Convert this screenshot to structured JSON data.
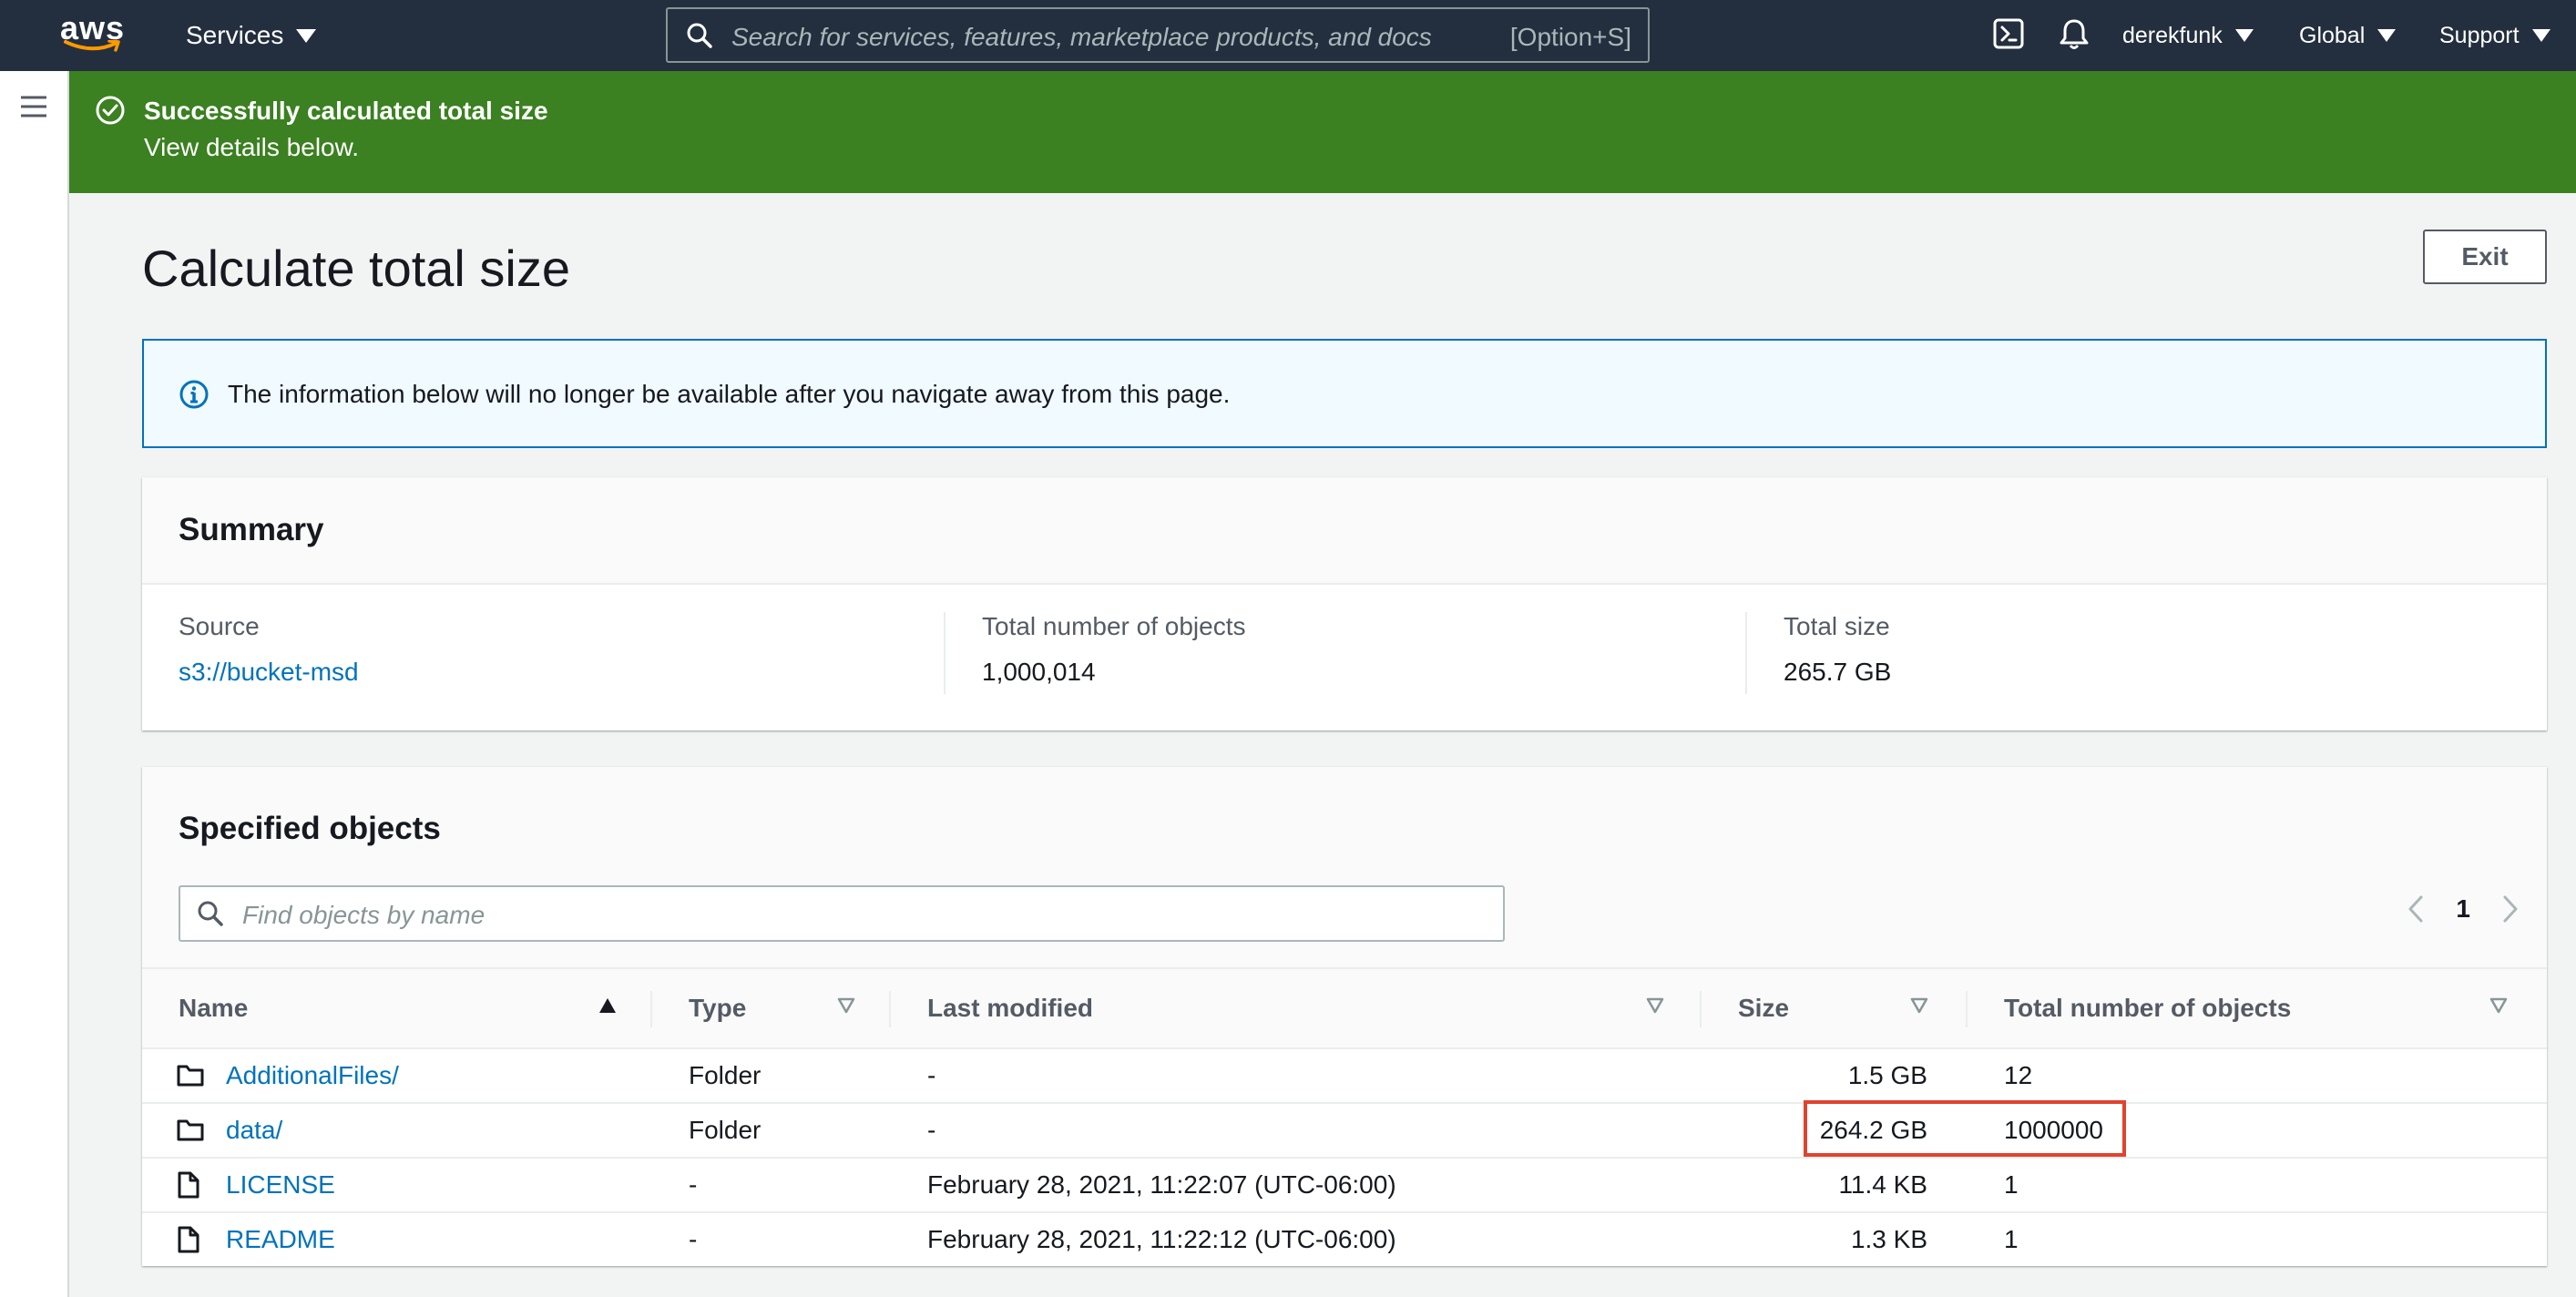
{
  "topnav": {
    "logo": "aws",
    "services_label": "Services",
    "search_placeholder": "Search for services, features, marketplace products, and docs",
    "search_shortcut": "[Option+S]",
    "user_label": "derekfunk",
    "region_label": "Global",
    "support_label": "Support"
  },
  "flash": {
    "title": "Successfully calculated total size",
    "message": "View details below.",
    "status_color": "#3b8021"
  },
  "page": {
    "title": "Calculate total size",
    "exit_label": "Exit"
  },
  "info_alert": {
    "text": "The information below will no longer be available after you navigate away from this page."
  },
  "summary": {
    "title": "Summary",
    "source_label": "Source",
    "source_value": "s3://bucket-msd",
    "objects_label": "Total number of objects",
    "objects_value": "1,000,014",
    "size_label": "Total size",
    "size_value": "265.7 GB"
  },
  "specified_objects": {
    "title": "Specified objects",
    "find_placeholder": "Find objects by name",
    "current_page": "1",
    "columns": [
      "Name",
      "Type",
      "Last modified",
      "Size",
      "Total number of objects"
    ],
    "rows": [
      {
        "name": "AdditionalFiles/",
        "icon": "folder-icon",
        "type": "Folder",
        "last_modified": "-",
        "size": "1.5 GB",
        "total_objects": "12"
      },
      {
        "name": "data/",
        "icon": "folder-icon",
        "type": "Folder",
        "last_modified": "-",
        "size": "264.2 GB",
        "total_objects": "1000000"
      },
      {
        "name": "LICENSE",
        "icon": "file-icon",
        "type": "-",
        "last_modified": "February 28, 2021, 11:22:07 (UTC-06:00)",
        "size": "11.4 KB",
        "total_objects": "1"
      },
      {
        "name": "README",
        "icon": "file-icon",
        "type": "-",
        "last_modified": "February 28, 2021, 11:22:12 (UTC-06:00)",
        "size": "1.3 KB",
        "total_objects": "1"
      }
    ]
  }
}
